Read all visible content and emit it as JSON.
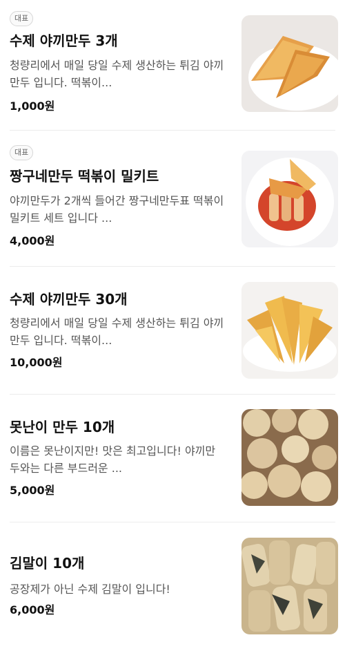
{
  "menu": {
    "items": [
      {
        "badge": "대표",
        "name": "수제 야끼만두 3개",
        "description": "청량리에서 매일 당일 수제 생산하는 튀김 야끼만두 입니다. 떡볶이...",
        "price": "1,000원",
        "image": "fried-dumplings-plate"
      },
      {
        "badge": "대표",
        "name": "짱구네만두 떡볶이 밀키트",
        "description": "야끼만두가 2개씩 들어간 짱구네만두표 떡볶이 밀키트 세트 입니다 ...",
        "price": "4,000원",
        "image": "tteokbokki-bowl"
      },
      {
        "name": "수제 야끼만두 30개",
        "description": "청량리에서 매일 당일 수제 생산하는 튀김 야끼만두 입니다. 떡볶이...",
        "price": "10,000원",
        "image": "fried-dumplings-pile"
      },
      {
        "name": "못난이 만두 10개",
        "description": "이름은 못난이지만! 맛은 최고입니다! 야끼만두와는 다른 부드러운 ...",
        "price": "5,000원",
        "image": "ugly-dumplings"
      },
      {
        "name": "김말이 10개",
        "description": "공장제가 아닌 수제 김말이 입니다!",
        "price": "6,000원",
        "image": "gimmari-fried-seaweed-rolls"
      }
    ]
  }
}
